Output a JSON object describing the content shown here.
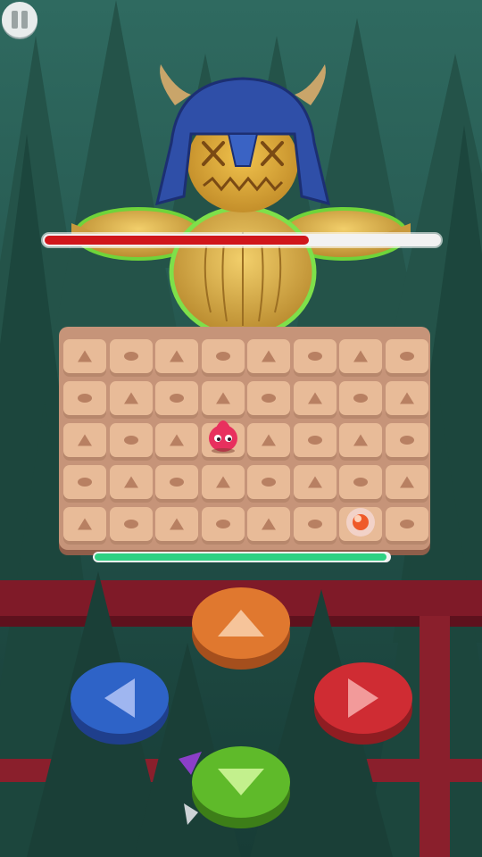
{
  "game": {
    "boss": {
      "name_icon": "scarecrow-viking-boss",
      "health_fraction": 0.67
    },
    "player": {
      "character_icon": "pink-blob-hero",
      "health_fraction": 0.99
    },
    "pickup": {
      "icon": "orange-orb"
    },
    "board": {
      "rows": [
        [
          "triangle",
          "circle",
          "triangle",
          "circle",
          "triangle",
          "circle",
          "triangle",
          "circle"
        ],
        [
          "circle",
          "triangle",
          "circle",
          "triangle",
          "circle",
          "triangle",
          "circle",
          "triangle"
        ],
        [
          "triangle",
          "circle",
          "triangle",
          "player",
          "triangle",
          "circle",
          "triangle",
          "circle"
        ],
        [
          "circle",
          "triangle",
          "circle",
          "triangle",
          "circle",
          "triangle",
          "circle",
          "triangle"
        ],
        [
          "triangle",
          "circle",
          "triangle",
          "circle",
          "triangle",
          "circle",
          "orb",
          "circle"
        ]
      ]
    },
    "controls": {
      "up": {
        "icon": "arrow-up-icon",
        "color": "#e0782f",
        "shade": "#a54f1d",
        "arrow": "#f6c49a"
      },
      "left": {
        "icon": "arrow-left-icon",
        "color": "#2e63c7",
        "shade": "#1f3f8c",
        "arrow": "#9fb6f0"
      },
      "right": {
        "icon": "arrow-right-icon",
        "color": "#cf2c33",
        "shade": "#8f1d22",
        "arrow": "#f29a9a"
      },
      "down": {
        "icon": "arrow-down-icon",
        "color": "#5fba2a",
        "shade": "#3d7e18",
        "arrow": "#c3f08d"
      }
    },
    "pause": {
      "icon": "pause-icon"
    }
  }
}
